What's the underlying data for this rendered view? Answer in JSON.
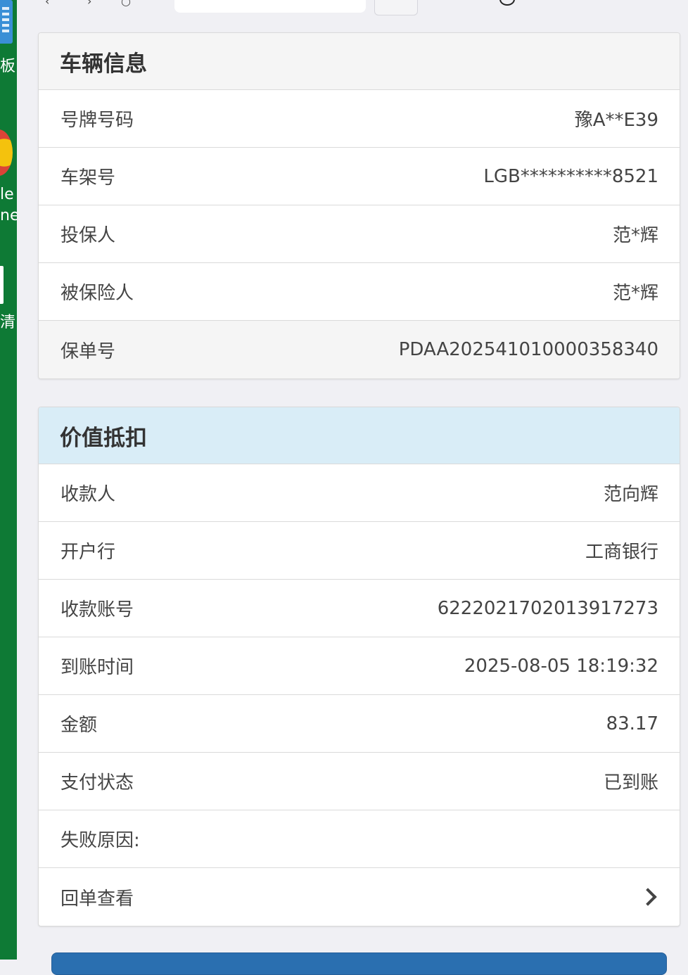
{
  "desktop": {
    "labels": [
      "板",
      "le",
      "ne",
      "清"
    ]
  },
  "vehicle_panel": {
    "title": "车辆信息",
    "rows": [
      {
        "label": "号牌号码",
        "value": "豫A**E39"
      },
      {
        "label": "车架号",
        "value": "LGB**********8521"
      },
      {
        "label": "投保人",
        "value": "范*辉"
      },
      {
        "label": "被保险人",
        "value": "范*辉"
      },
      {
        "label": "保单号",
        "value": "PDAA202541010000358340"
      }
    ]
  },
  "value_panel": {
    "title": "价值抵扣",
    "rows": [
      {
        "label": "收款人",
        "value": "范向辉"
      },
      {
        "label": "开户行",
        "value": "工商银行"
      },
      {
        "label": "收款账号",
        "value": "6222021702013917273"
      },
      {
        "label": "到账时间",
        "value": "2025-08-05 18:19:32"
      },
      {
        "label": "金额",
        "value": "83.17"
      },
      {
        "label": "支付状态",
        "value": "已到账"
      },
      {
        "label": "失败原因:",
        "value": ""
      },
      {
        "label": "回单查看",
        "icon": "chevron-right-icon"
      }
    ]
  },
  "colors": {
    "desktop_green": "#0e7a35",
    "value_header_bg": "#d9edf7",
    "vehicle_header_bg": "#f5f5f5",
    "bottom_button": "#2a6fb0"
  }
}
